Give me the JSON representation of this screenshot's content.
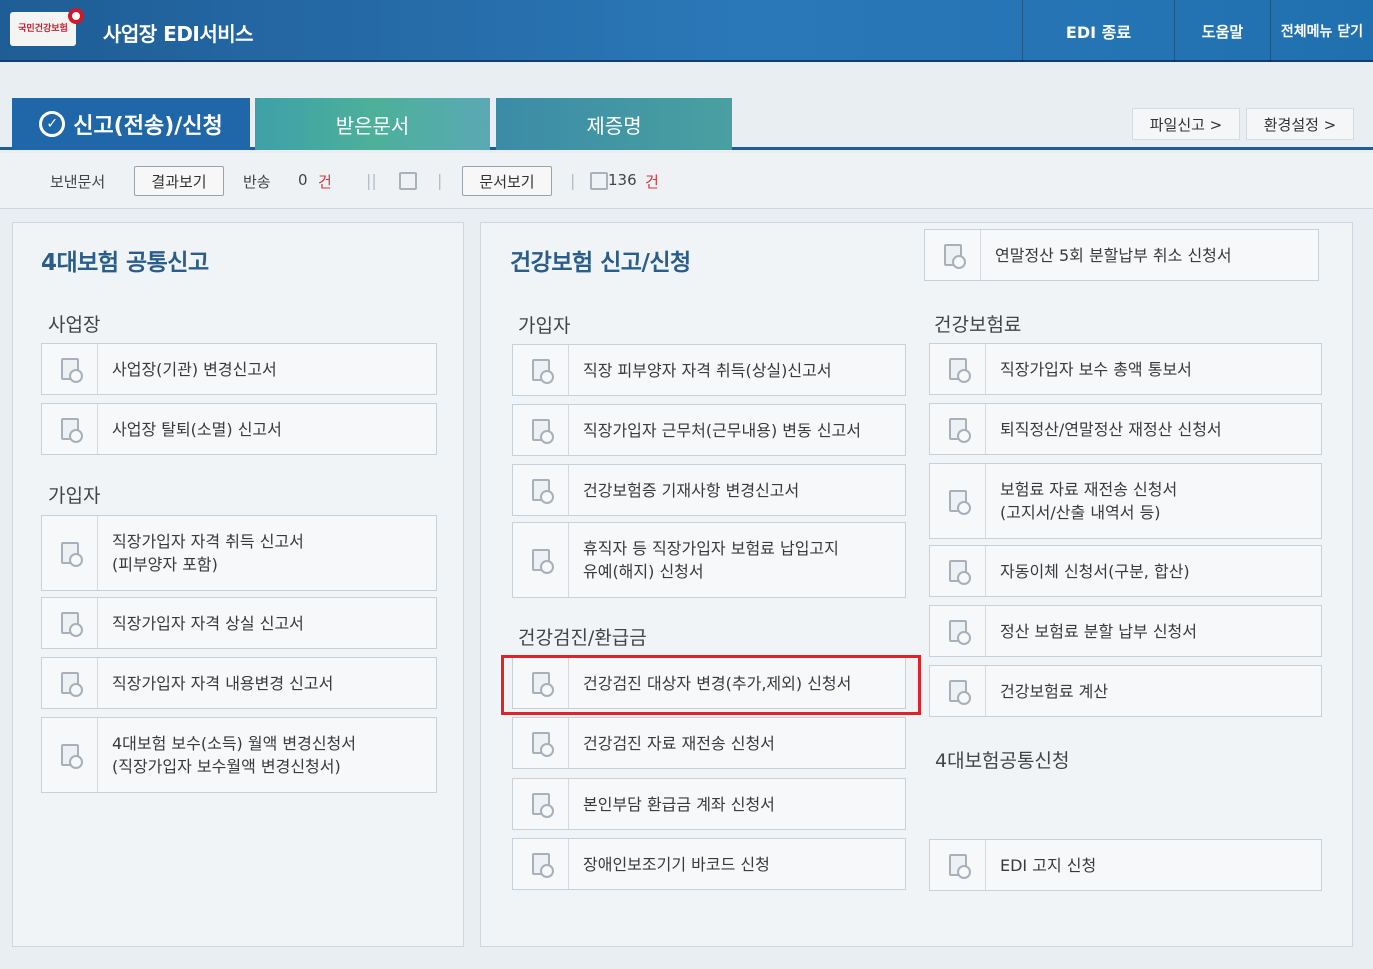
{
  "header": {
    "logo_text": "국민건강보험",
    "service_title": "사업장 EDI서비스",
    "buttons": {
      "edi_exit": "EDI 종료",
      "help": "도움말",
      "close_all": "전체메뉴 닫기"
    }
  },
  "tabs": [
    {
      "label": "신고(전송)/신청"
    },
    {
      "label": "받은문서"
    },
    {
      "label": "제증명"
    }
  ],
  "top_links": {
    "file_report": "파일신고 >",
    "settings": "환경설정 >"
  },
  "toolbar": {
    "sent_docs": "보낸문서",
    "view_results": "결과보기",
    "returned": "반송",
    "returned_count": "0",
    "unit": "건",
    "view_docs": "문서보기",
    "doc_count": "136"
  },
  "left_panel": {
    "title": "4대보험 공통신고",
    "sections": {
      "workplace": {
        "title": "사업장",
        "items": [
          "사업장(기관) 변경신고서",
          "사업장 탈퇴(소멸) 신고서"
        ]
      },
      "subscriber": {
        "title": "가입자",
        "items": [
          [
            "직장가입자 자격 취득 신고서",
            "(피부양자 포함)"
          ],
          [
            "직장가입자 자격 상실 신고서"
          ],
          [
            "직장가입자 자격 내용변경 신고서"
          ],
          [
            "4대보험 보수(소득) 월액 변경신청서",
            "(직장가입자 보수월액 변경신청서)"
          ]
        ]
      }
    }
  },
  "right_panel": {
    "title": "건강보험 신고/신청",
    "top_item": "연말정산 5회 분할납부 취소 신청서",
    "subscriber": {
      "title": "가입자",
      "items": [
        [
          "직장 피부양자 자격 취득(상실)신고서"
        ],
        [
          "직장가입자 근무처(근무내용) 변동 신고서"
        ],
        [
          "건강보험증 기재사항 변경신고서"
        ],
        [
          "휴직자 등 직장가입자 보험료 납입고지",
          "유예(해지) 신청서"
        ]
      ]
    },
    "checkup": {
      "title": "건강검진/환급금",
      "items": [
        "건강검진 대상자 변경(추가,제외) 신청서",
        "건강검진 자료 재전송 신청서",
        "본인부담 환급금 계좌 신청서",
        "장애인보조기기 바코드 신청"
      ]
    },
    "premium": {
      "title": "건강보험료",
      "items": [
        [
          "직장가입자 보수 총액 통보서"
        ],
        [
          "퇴직정산/연말정산 재정산 신청서"
        ],
        [
          "보험료 자료 재전송 신청서",
          "(고지서/산출 내역서 등)"
        ],
        [
          "자동이체 신청서(구분, 합산)"
        ],
        [
          "정산 보험료 분할 납부 신청서"
        ],
        [
          "건강보험료 계산"
        ]
      ]
    },
    "common": {
      "title": "4대보험공통신청",
      "items": [
        "EDI 고지 신청"
      ]
    }
  },
  "colors": {
    "header_blue": "#2b78b8",
    "active_tab": "#1f67a8",
    "highlight_red": "#e0222a"
  }
}
